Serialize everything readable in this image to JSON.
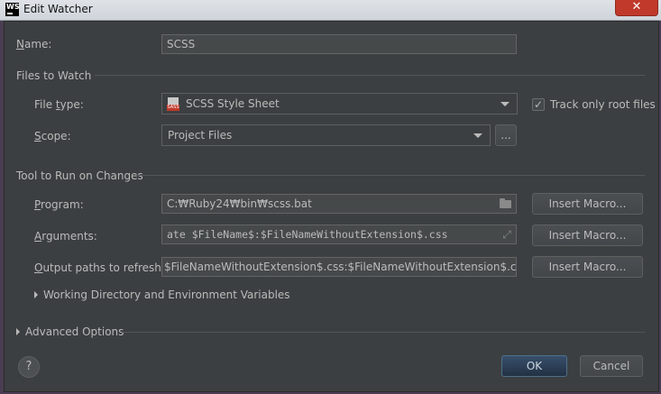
{
  "window": {
    "title": "Edit Watcher",
    "close_glyph": "✕",
    "logo": "WS"
  },
  "name_field": {
    "label_u": "N",
    "label_rest": "ame:",
    "value": "SCSS"
  },
  "files_to_watch": {
    "section_title": "Files to Watch",
    "file_type": {
      "label_pre": "File ",
      "label_u": "t",
      "label_rest": "ype:",
      "value": "SCSS Style Sheet",
      "icon": "sass-file-icon",
      "icon_text": "SASS"
    },
    "track_root": {
      "label": "Track only root files",
      "checked": true
    },
    "scope": {
      "label_u": "S",
      "label_rest": "cope:",
      "value": "Project Files",
      "browse_label": "..."
    }
  },
  "tool_to_run": {
    "section_title": "Tool to Run on Changes",
    "program": {
      "label_u": "P",
      "label_rest": "rogram:",
      "value": "C:₩Ruby24₩bin₩scss.bat",
      "macro_label": "Insert Macro..."
    },
    "arguments": {
      "label_u": "A",
      "label_rest": "rguments:",
      "value": "ate $FileName$:$FileNameWithoutExtension$.css",
      "macro_label": "Insert Macro..."
    },
    "output_paths": {
      "label_u": "O",
      "label_rest": "utput paths to refresh:",
      "value": "$FileNameWithoutExtension$.css:$FileNameWithoutExtension$.css.map",
      "macro_label": "Insert Macro..."
    },
    "working_dir": {
      "label": "Working Directory and Environment Variables"
    }
  },
  "advanced": {
    "label": "Advanced Options"
  },
  "footer": {
    "help_label": "?",
    "ok_label": "OK",
    "cancel_label": "Cancel"
  },
  "colors": {
    "dialog_bg": "#3c3f41",
    "field_bg": "#45494a",
    "text": "#bbbbbb",
    "close": "#c0392b",
    "ok": "#2f4a66"
  }
}
